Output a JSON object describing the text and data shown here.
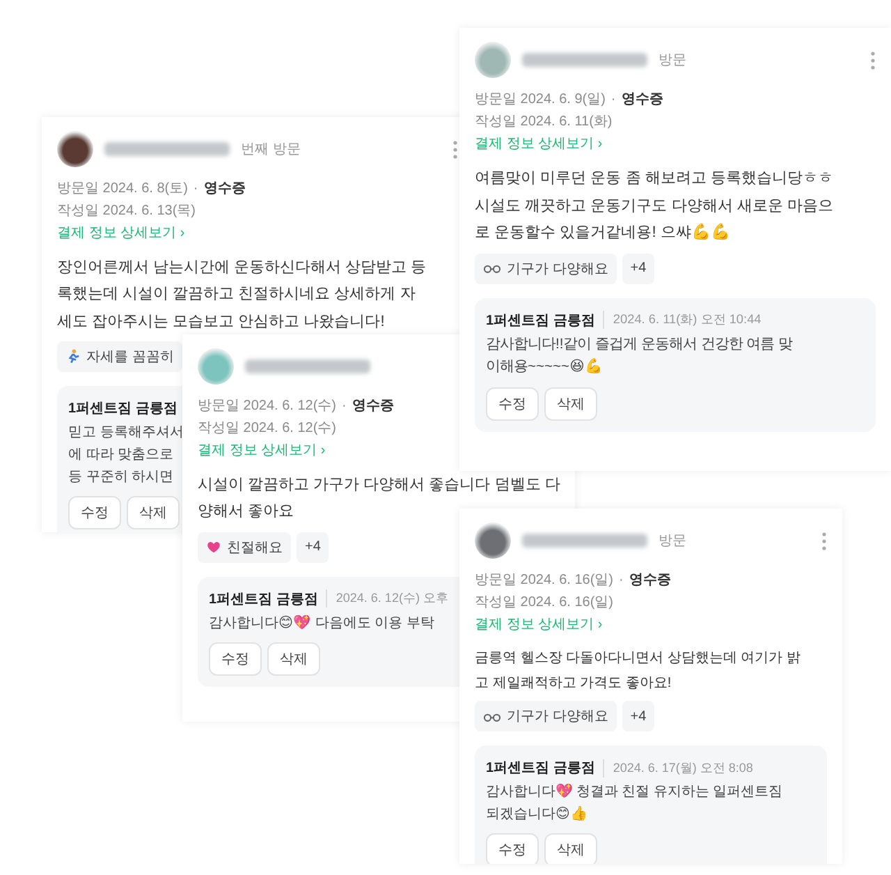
{
  "reviews": [
    {
      "visit_count": "번째 방문",
      "visit_date": "방문일 2024. 6. 8(토)",
      "separator": "·",
      "receipt": "영수증",
      "written": "작성일 2024. 6. 13(목)",
      "link": "결제 정보 상세보기 ›",
      "body": [
        "장인어른께서 남는시간에 운동하신다해서 상담받고 등",
        "록했는데 시설이 깔끔하고 친절하시네요 상세하게 자",
        "세도 잡아주시는 모습보고 안심하고 나왔습니다!"
      ],
      "chips": [
        {
          "kind": "runner",
          "label": "자세를 꼼꼼히"
        }
      ],
      "menu": true,
      "reply": {
        "owner": "1퍼센트짐 금릉점",
        "lines": [
          "믿고 등록해주셔서",
          "에 따라 맞춤으로",
          "등 꾸준히 하시면"
        ],
        "buttons": [
          "수정",
          "삭제"
        ]
      }
    },
    {
      "visit_date": "방문일 2024. 6. 12(수)",
      "separator": "·",
      "receipt": "영수증",
      "written": "작성일 2024. 6. 12(수)",
      "link": "결제 정보 상세보기 ›",
      "body": [
        "시설이 깔끔하고 가구가 다양해서 좋습니다 덤벨도 다",
        "양해서 좋아요"
      ],
      "chips": [
        {
          "kind": "heart",
          "label": "친절해요"
        },
        {
          "kind": "count",
          "label": "+4"
        }
      ],
      "menu": false,
      "reply": {
        "owner": "1퍼센트짐 금릉점",
        "date": "2024. 6. 12(수) 오후",
        "lines": [
          "감사합니다😊💖 다음에도 이용 부탁"
        ],
        "buttons": [
          "수정",
          "삭제"
        ]
      }
    },
    {
      "visit_count": "방문",
      "visit_date": "방문일 2024. 6. 9(일)",
      "separator": "·",
      "receipt": "영수증",
      "written": "작성일 2024. 6. 11(화)",
      "link": "결제 정보 상세보기 ›",
      "body": [
        "여름맞이 미루던 운동 좀 해보려고 등록했습니당ㅎㅎ",
        "시설도 깨끗하고 운동기구도 다양해서 새로운 마음으",
        "로 운동할수 있을거같네용! 으쌰💪💪"
      ],
      "chips": [
        {
          "kind": "glasses",
          "label": "기구가 다양해요"
        },
        {
          "kind": "count",
          "label": "+4"
        }
      ],
      "menu": true,
      "reply": {
        "owner": "1퍼센트짐 금릉점",
        "date": "2024. 6. 11(화) 오전 10:44",
        "lines": [
          "감사합니다!!같이 즐겁게 운동해서 건강한 여름 맞",
          "이해용~~~~~😆💪"
        ],
        "buttons": [
          "수정",
          "삭제"
        ]
      }
    },
    {
      "visit_count": "방문",
      "visit_date": "방문일 2024. 6. 16(일)",
      "separator": "·",
      "receipt": "영수증",
      "written": "작성일 2024. 6. 16(일)",
      "link": "결제 정보 상세보기 ›",
      "body": [
        "금릉역 헬스장 다돌아다니면서 상담했는데 여기가 밝",
        "고 제일쾌적하고 가격도 좋아요!"
      ],
      "chips": [
        {
          "kind": "glasses",
          "label": "기구가 다양해요"
        },
        {
          "kind": "count",
          "label": "+4"
        }
      ],
      "menu": true,
      "reply": {
        "owner": "1퍼센트짐 금릉점",
        "date": "2024. 6. 17(월) 오전 8:08",
        "lines": [
          "감사합니다💖 청결과 친절 유지하는 일퍼센트짐",
          "되겠습니다😊👍"
        ],
        "buttons": [
          "수정",
          "삭제"
        ]
      }
    }
  ]
}
